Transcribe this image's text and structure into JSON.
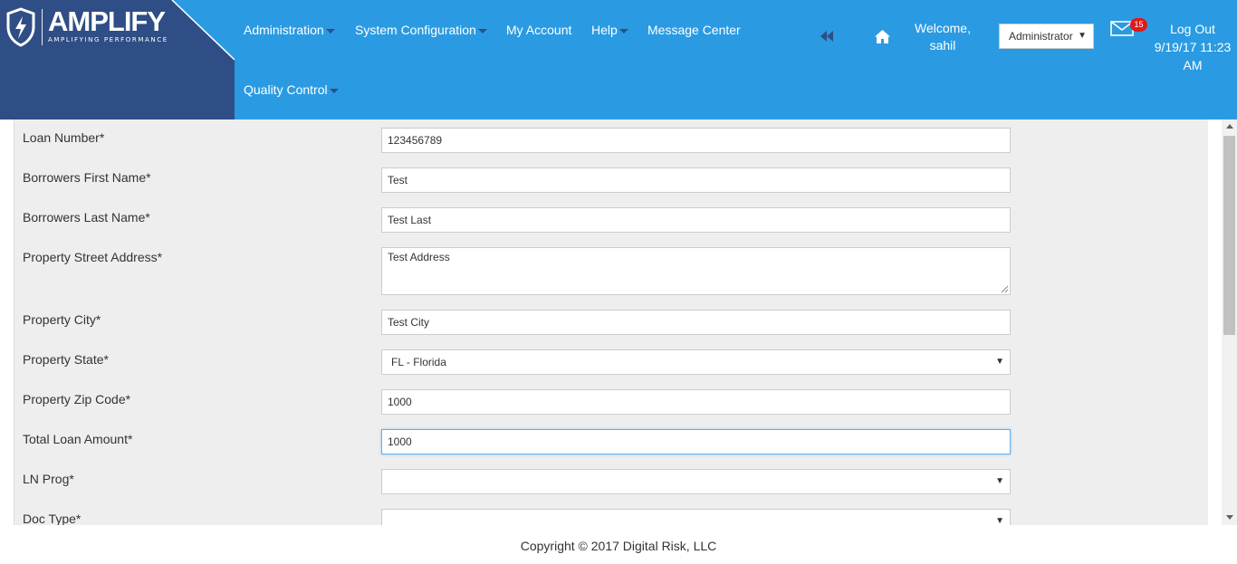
{
  "brand": {
    "name": "AMPLIFY",
    "tagline": "AMPLIFYING PERFORMANCE",
    "color": "#2f4e86"
  },
  "nav": [
    {
      "label": "Administration",
      "has_caret": true
    },
    {
      "label": "System Configuration",
      "has_caret": true
    },
    {
      "label": "My Account",
      "has_caret": false
    },
    {
      "label": "Help",
      "has_caret": true
    },
    {
      "label": "Message Center",
      "has_caret": false
    },
    {
      "label": "Quality Control",
      "has_caret": true
    }
  ],
  "header": {
    "bg_color": "#2a9be2",
    "welcome_line1": "Welcome,",
    "welcome_line2": "sahil",
    "role_selected": "Administrator",
    "mail_count": "15",
    "logout_label": "Log Out",
    "datetime_line1": "9/19/17 11:23",
    "datetime_line2": "AM"
  },
  "form": {
    "fields": [
      {
        "label": "Loan Number*",
        "value": "123456789"
      },
      {
        "label": "Borrowers First Name*",
        "value": "Test"
      },
      {
        "label": "Borrowers Last Name*",
        "value": "Test Last"
      },
      {
        "label": "Property Street Address*",
        "value": "Test Address"
      },
      {
        "label": "Property City*",
        "value": "Test City"
      },
      {
        "label": "Property State*",
        "value": "FL - Florida"
      },
      {
        "label": "Property Zip Code*",
        "value": "1000"
      },
      {
        "label": "Total Loan Amount*",
        "value": "1000"
      },
      {
        "label": "LN Prog*",
        "value": ""
      },
      {
        "label": "Doc Type*",
        "value": ""
      }
    ]
  },
  "footer": {
    "copyright": "Copyright © 2017 Digital Risk, LLC"
  }
}
